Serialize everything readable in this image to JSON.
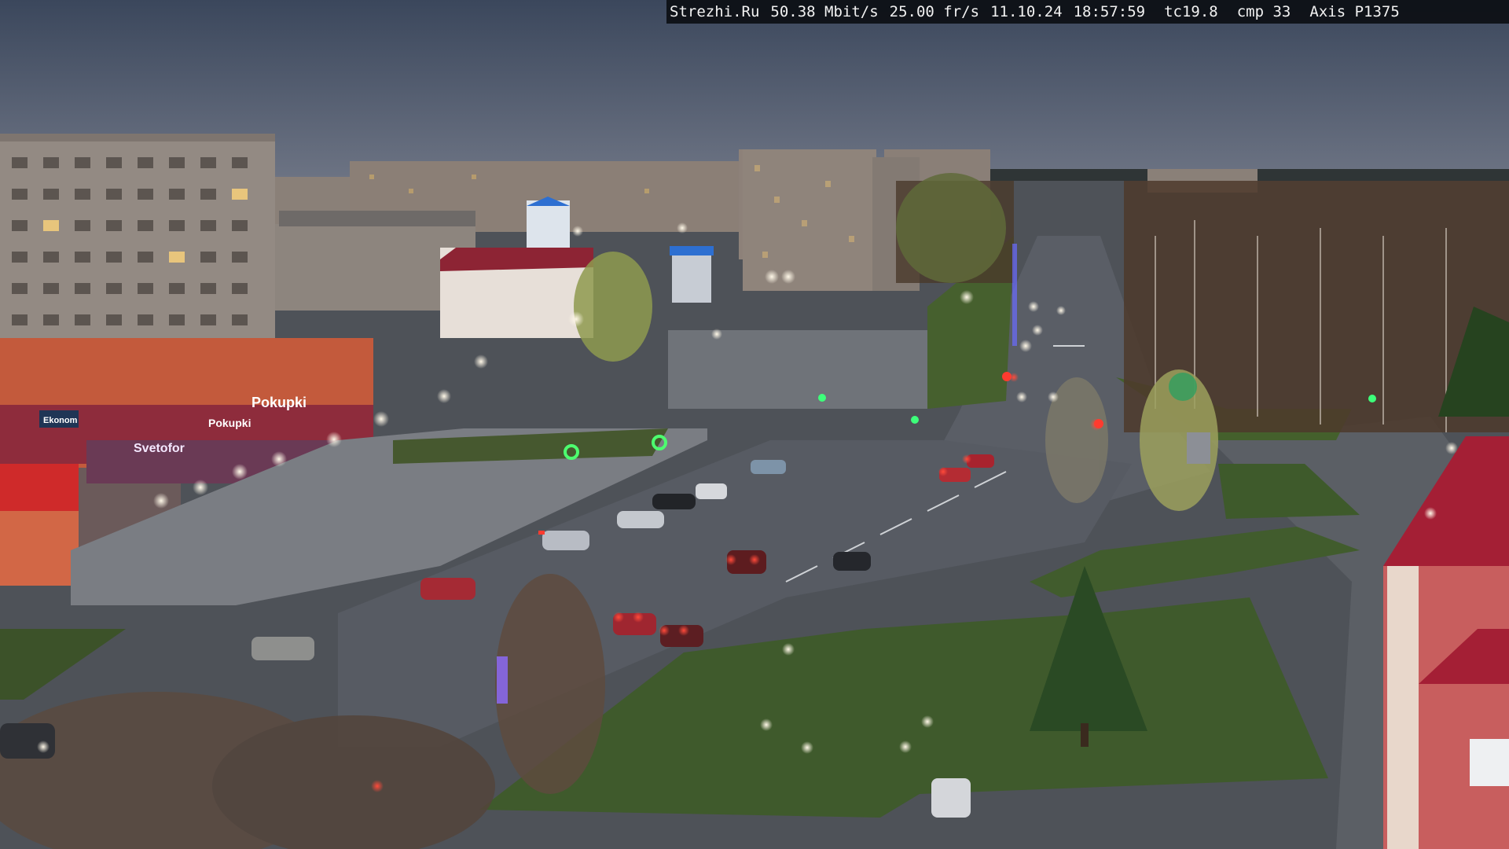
{
  "osd": {
    "site": "Strezhi.Ru",
    "bitrate": "50.38 Mbit/s",
    "framerate": "25.00 fr/s",
    "date": "11.10.24",
    "time": "18:57:59",
    "temperature": "tc19.8",
    "compression": "cmp 33",
    "camera_model": "Axis P1375"
  },
  "storefront_signs": {
    "sign_1": "Svetofor",
    "sign_2": "Pokupki",
    "sign_3": "Pokupki",
    "sign_4": "Ekonom"
  },
  "colors": {
    "sky": "#3e4a5f",
    "grass": "#3d5a2b",
    "asphalt": "#5c6068",
    "red_roof": "#a41f35"
  }
}
